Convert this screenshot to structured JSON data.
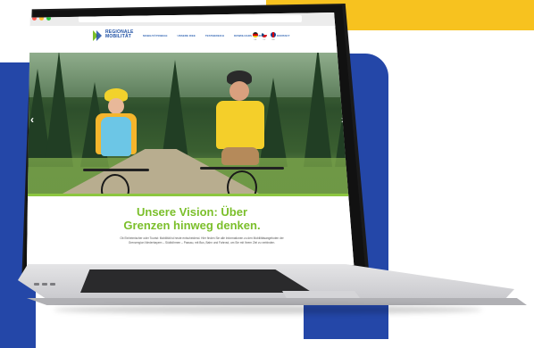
{
  "brand": {
    "name_line1": "REGIONALE",
    "name_line2": "MOBILITÄT",
    "logo_colors": [
      "#7bbf2b",
      "#1d4fa3"
    ]
  },
  "nav": {
    "items": [
      "Mobilitätswege",
      "Unsere Idee",
      "Testbereich",
      "Downloads & Service",
      "Kontakt"
    ]
  },
  "languages": [
    "DE",
    "CZ",
    "EN"
  ],
  "hero": {
    "prev_icon": "chevron-left-icon",
    "next_icon": "chevron-right-icon"
  },
  "content": {
    "headline_line1": "Unsere Vision: Über",
    "headline_line2": "Grenzen hinweg denken.",
    "body": "Ob Einheimischer oder Tourist: Mobilität ist heute entscheidend. Hier finden Sie alle Informationen zu den Mobilitätsangeboten der Grenzregion Niederbayern – Südböhmen – Passau, mit Bus, Bahn und Fahrrad, um Sie mit Ihrem Ziel zu verbinden."
  },
  "colors": {
    "accent_green": "#7bbf2b",
    "brand_blue": "#2447a8",
    "background_yellow": "#f7c21f"
  }
}
